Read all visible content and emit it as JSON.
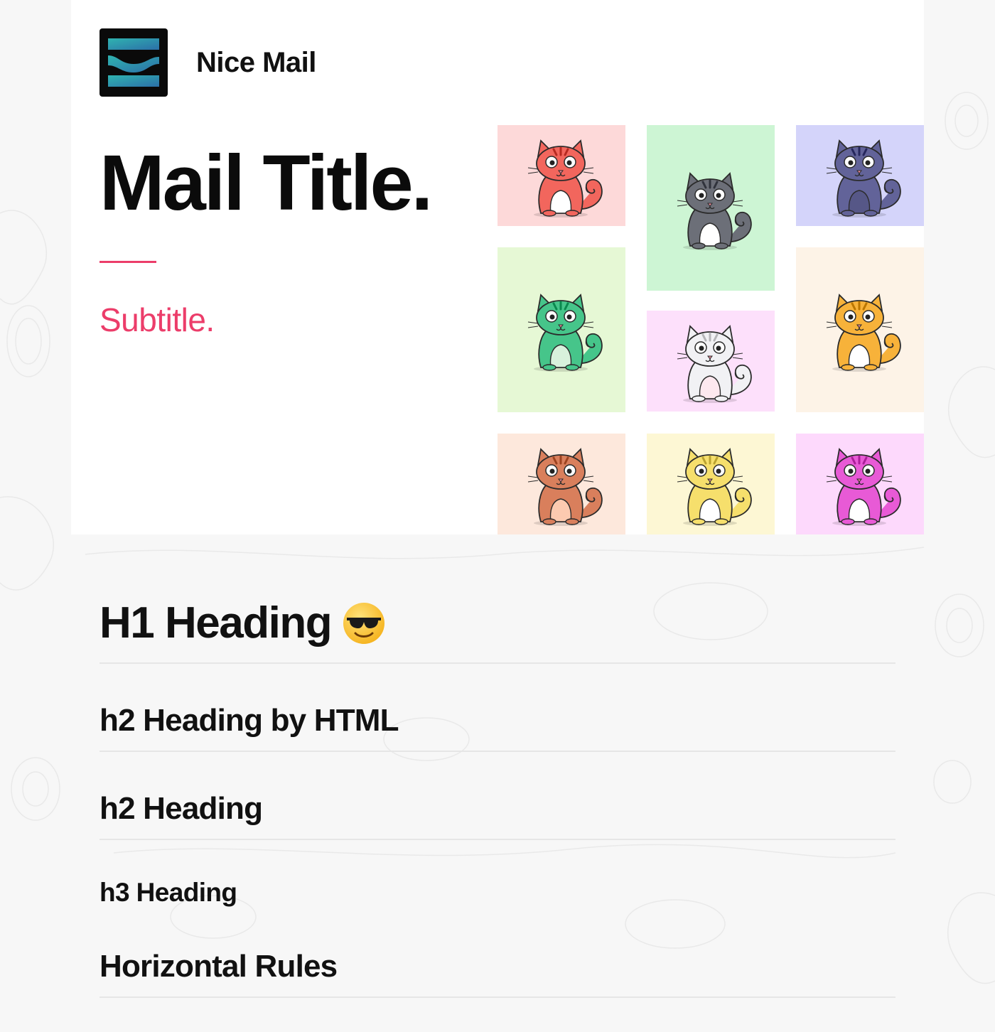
{
  "brand": {
    "name": "Nice Mail",
    "logo_icon": "nice-mail-logo-icon"
  },
  "hero": {
    "title": "Mail Title.",
    "subtitle": "Subtitle.",
    "accent_color": "#ec3d6a",
    "kitties": [
      {
        "name": "kitty-red",
        "bg": "#fdd9d9",
        "body": "#f2665d",
        "belly": "#ffffff",
        "icon": "cat-icon"
      },
      {
        "name": "kitty-gray",
        "bg": "#cdf5d4",
        "body": "#6c6f78",
        "belly": "#ffffff",
        "icon": "cat-icon"
      },
      {
        "name": "kitty-indigo",
        "bg": "#d4d4fa",
        "body": "#626399",
        "belly": "#565787",
        "icon": "cat-icon"
      },
      {
        "name": "kitty-green",
        "bg": "#e6f8d5",
        "body": "#46c58a",
        "belly": "#d8f1dc",
        "icon": "cat-icon"
      },
      {
        "name": "kitty-pink",
        "bg": "#fde0fb",
        "body": "#f1f1f4",
        "belly": "#fde8ef",
        "icon": "cat-icon"
      },
      {
        "name": "kitty-orange",
        "bg": "#fdf3e7",
        "body": "#f7b23a",
        "belly": "#ffffff",
        "icon": "cat-icon"
      },
      {
        "name": "kitty-calico",
        "bg": "#fde8dc",
        "body": "#d97f5c",
        "belly": "#fccab0",
        "icon": "cat-icon"
      },
      {
        "name": "kitty-yellow",
        "bg": "#fdf7d4",
        "body": "#f6df6c",
        "belly": "#ffffff",
        "icon": "cat-icon"
      },
      {
        "name": "kitty-magenta",
        "bg": "#fdd9fc",
        "body": "#e85ad6",
        "belly": "#ffffff",
        "icon": "cat-icon"
      }
    ]
  },
  "content": {
    "h1": "H1 Heading",
    "h1_emoji": "sunglasses-emoji-icon",
    "h2_html": "h2 Heading by HTML",
    "h2": "h2 Heading",
    "h3": "h3 Heading",
    "h_rules": "Horizontal Rules"
  }
}
